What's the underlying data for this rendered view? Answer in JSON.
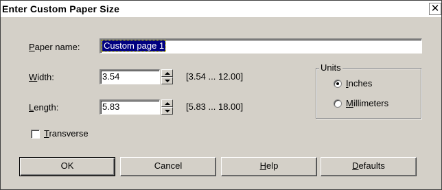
{
  "window": {
    "title": "Enter Custom Paper Size",
    "close_glyph": "✕"
  },
  "paper_name": {
    "label_prefix": "",
    "label_mnemonic": "P",
    "label_rest": "aper name:",
    "value": "Custom page 1"
  },
  "width": {
    "label_mnemonic": "W",
    "label_rest": "idth:",
    "value": "3.54",
    "range": "[3.54 ... 12.00]"
  },
  "length": {
    "label_mnemonic": "L",
    "label_rest": "ength:",
    "value": "5.83",
    "range": "[5.83 ... 18.00]"
  },
  "units": {
    "title": "Units",
    "options": [
      {
        "mnemonic": "I",
        "rest": "nches",
        "selected": true
      },
      {
        "mnemonic": "M",
        "rest": "illimeters",
        "selected": false
      }
    ]
  },
  "transverse": {
    "mnemonic": "T",
    "rest": "ransverse",
    "checked": false
  },
  "buttons": {
    "ok": "OK",
    "cancel": "Cancel",
    "help_mnemonic": "H",
    "help_rest": "elp",
    "defaults_mnemonic": "D",
    "defaults_rest": "efaults"
  }
}
